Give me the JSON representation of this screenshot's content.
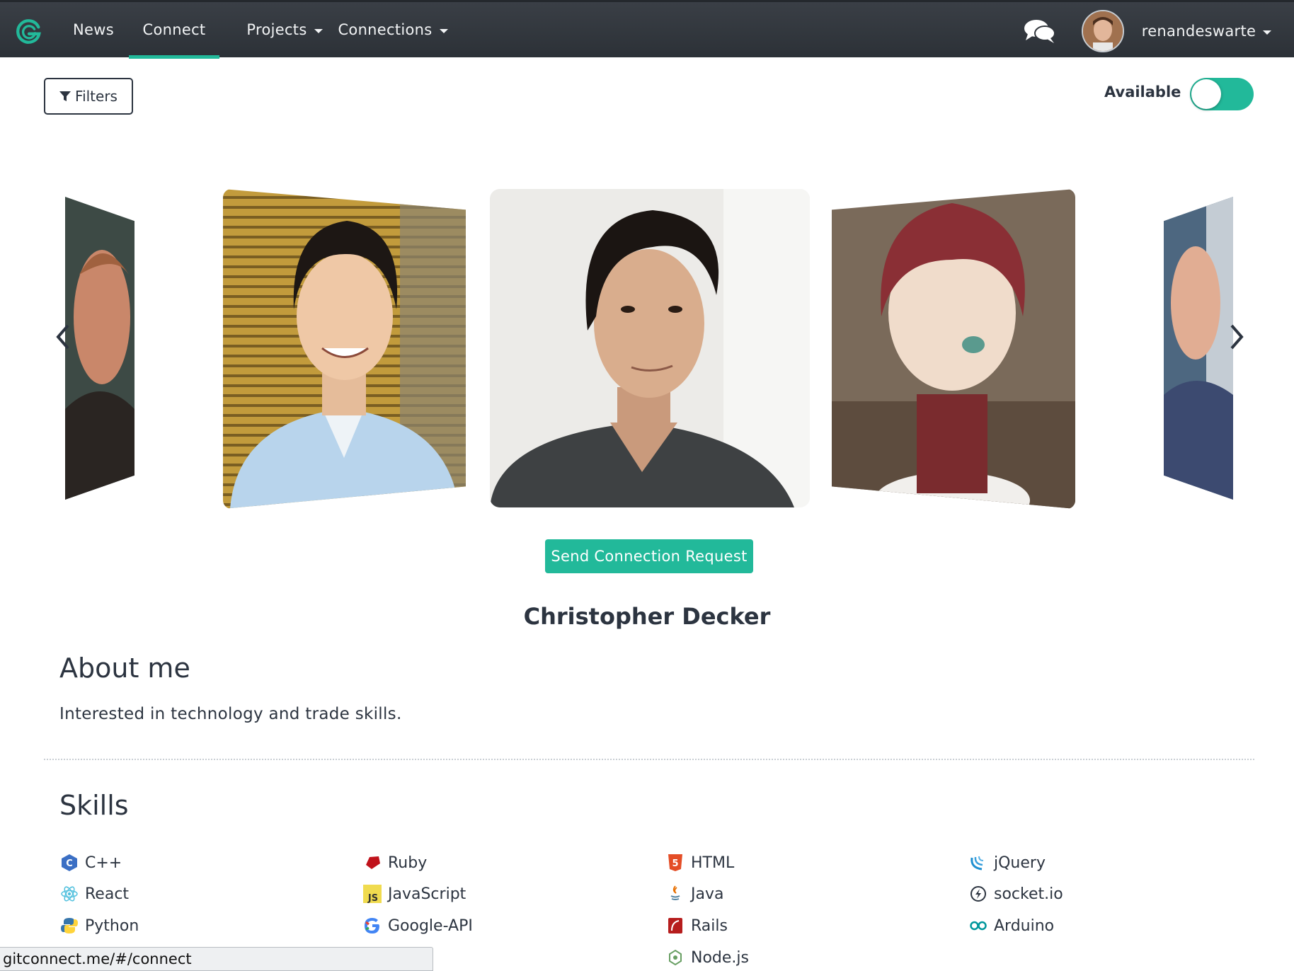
{
  "nav": {
    "items": [
      {
        "label": "News"
      },
      {
        "label": "Connect"
      },
      {
        "label": "Projects"
      },
      {
        "label": "Connections"
      }
    ],
    "username": "renandeswarte"
  },
  "toolbar": {
    "filters_label": "Filters",
    "available_label": "Available",
    "available_on": true
  },
  "profile": {
    "connect_button": "Send Connection Request",
    "name": "Christopher Decker",
    "about_title": "About me",
    "about_text": "Interested in technology and trade skills.",
    "skills_title": "Skills",
    "skills": [
      {
        "label": "C++",
        "icon": "cpp-icon"
      },
      {
        "label": "Ruby",
        "icon": "ruby-icon"
      },
      {
        "label": "HTML",
        "icon": "html5-icon"
      },
      {
        "label": "jQuery",
        "icon": "jquery-icon"
      },
      {
        "label": "React",
        "icon": "react-icon"
      },
      {
        "label": "JavaScript",
        "icon": "javascript-icon"
      },
      {
        "label": "Java",
        "icon": "java-icon"
      },
      {
        "label": "socket.io",
        "icon": "socketio-icon"
      },
      {
        "label": "Python",
        "icon": "python-icon"
      },
      {
        "label": "Google-API",
        "icon": "google-icon"
      },
      {
        "label": "Rails",
        "icon": "rails-icon"
      },
      {
        "label": "Arduino",
        "icon": "arduino-icon"
      },
      {
        "label": "Node.js",
        "icon": "nodejs-icon"
      }
    ]
  },
  "status_bar": {
    "url": "gitconnect.me/#/connect"
  },
  "colors": {
    "accent": "#22b99a",
    "navbar": "#31363c",
    "text": "#2c3440"
  }
}
